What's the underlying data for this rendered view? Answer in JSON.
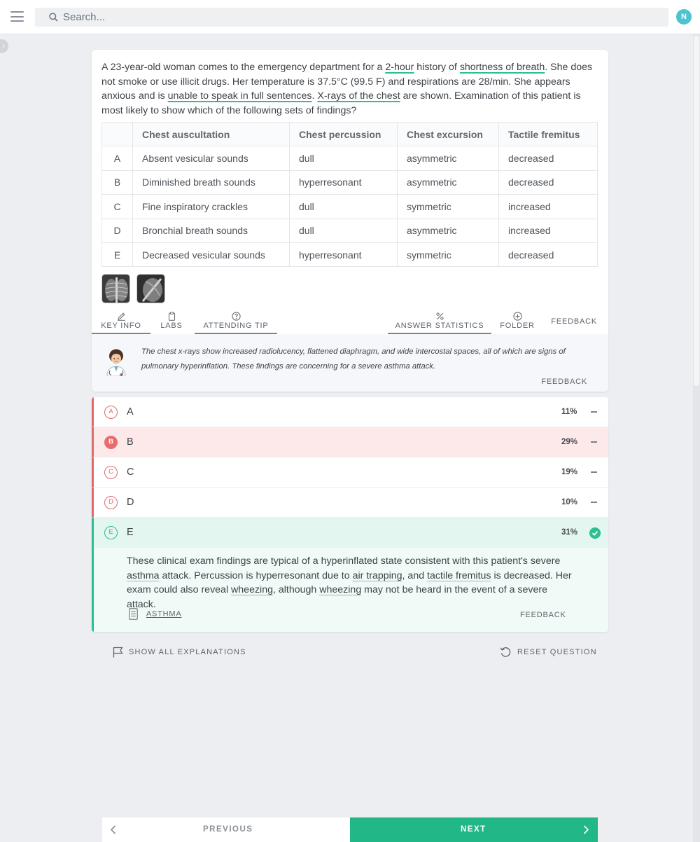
{
  "topbar": {
    "search_placeholder": "Search...",
    "avatar_initial": "N"
  },
  "question": {
    "stem": [
      "A 23-year-old woman comes to the emergency department for a ",
      "2-hour",
      " history of ",
      "shortness of breath",
      ". She does not smoke or use illicit drugs. Her temperature is 37.5°C (99.5 F) and respirations are 28/min. She appears anxious and is ",
      "unable to speak in full sentences",
      ". ",
      "X-rays of the chest",
      " are shown. Examination of this patient is most likely to show which of the following sets of findings?"
    ],
    "table": {
      "headers": [
        "",
        "Chest auscultation",
        "Chest percussion",
        "Chest excursion",
        "Tactile fremitus"
      ],
      "rows": [
        [
          "A",
          "Absent vesicular sounds",
          "dull",
          "asymmetric",
          "decreased"
        ],
        [
          "B",
          "Diminished breath sounds",
          "hyperresonant",
          "asymmetric",
          "decreased"
        ],
        [
          "C",
          "Fine inspiratory crackles",
          "dull",
          "symmetric",
          "increased"
        ],
        [
          "D",
          "Bronchial breath sounds",
          "dull",
          "asymmetric",
          "increased"
        ],
        [
          "E",
          "Decreased vesicular sounds",
          "hyperresonant",
          "symmetric",
          "decreased"
        ]
      ]
    }
  },
  "tools": {
    "key_info": "KEY INFO",
    "labs": "LABS",
    "attending_tip": "ATTENDING TIP",
    "answer_statistics": "ANSWER STATISTICS",
    "folder": "FOLDER",
    "feedback": "FEEDBACK"
  },
  "tip": {
    "text": "The chest x-rays show increased radiolucency, flattened diaphragm, and wide intercostal spaces, all of which are signs of pulmonary hyperinflation. These findings are concerning for a severe asthma attack.",
    "feedback": "FEEDBACK"
  },
  "answers": [
    {
      "letter": "A",
      "label": "A",
      "pct": "11%",
      "state": "incorrect"
    },
    {
      "letter": "B",
      "label": "B",
      "pct": "29%",
      "state": "selected"
    },
    {
      "letter": "C",
      "label": "C",
      "pct": "19%",
      "state": "incorrect"
    },
    {
      "letter": "D",
      "label": "D",
      "pct": "10%",
      "state": "incorrect"
    },
    {
      "letter": "E",
      "label": "E",
      "pct": "31%",
      "state": "correct"
    }
  ],
  "explanation": {
    "parts": [
      "These clinical exam findings are typical of a hyperinflated state consistent with this patient's severe ",
      "asthma",
      " attack. Percussion is hyperresonant due to ",
      "air trapping",
      ", and ",
      "tactile fremitus",
      " is decreased. Her exam could also reveal ",
      "wheezing",
      ", although ",
      "wheezing",
      " may not be heard in the event of a severe attack."
    ],
    "topic": "ASTHMA",
    "feedback": "FEEDBACK"
  },
  "actions": {
    "show_all": "SHOW ALL EXPLANATIONS",
    "reset": "RESET QUESTION"
  },
  "nav": {
    "previous": "PREVIOUS",
    "next": "NEXT"
  },
  "colors": {
    "accent_green": "#22b786",
    "incorrect_red": "#e06b6b",
    "selected_bg": "#fde8ea",
    "correct_bg": "#e4f6f0",
    "avatar": "#4cc3d0"
  }
}
